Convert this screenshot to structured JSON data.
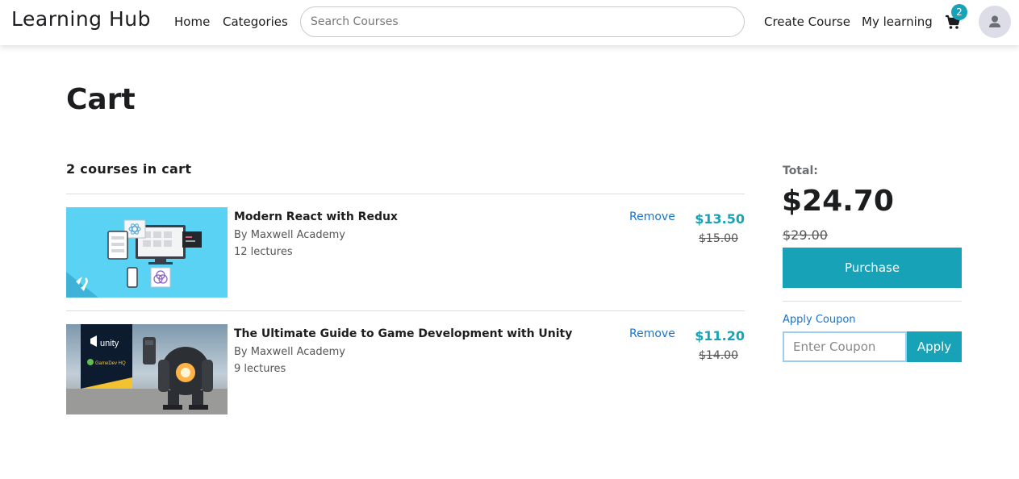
{
  "header": {
    "brand": "Learning Hub",
    "nav": {
      "home": "Home",
      "categories": "Categories"
    },
    "search_placeholder": "Search Courses",
    "create_course": "Create Course",
    "my_learning": "My learning",
    "cart_count": "2",
    "cart_icon": "shopping-cart-icon",
    "avatar_icon": "user-icon"
  },
  "page": {
    "title": "Cart",
    "count_text": "2 courses in cart"
  },
  "cart": {
    "items": [
      {
        "title": "Modern React with Redux",
        "author": "By Maxwell Academy",
        "lectures": "12 lectures",
        "remove": "Remove",
        "price": "$13.50",
        "old_price": "$15.00"
      },
      {
        "title": "The Ultimate Guide to Game Development with Unity",
        "author": "By Maxwell Academy",
        "lectures": "9 lectures",
        "remove": "Remove",
        "price": "$11.20",
        "old_price": "$14.00"
      }
    ]
  },
  "summary": {
    "total_label": "Total:",
    "total": "$24.70",
    "original_total": "$29.00",
    "purchase_label": "Purchase",
    "apply_coupon_link": "Apply Coupon",
    "coupon_placeholder": "Enter Coupon",
    "apply_label": "Apply"
  },
  "thumbnails": {
    "course1_logo_text": "unity",
    "course2_logo_text": "GameDev HQ"
  },
  "colors": {
    "accent": "#17a2b8",
    "link": "#1a73c8",
    "text": "#1c1d1f"
  }
}
